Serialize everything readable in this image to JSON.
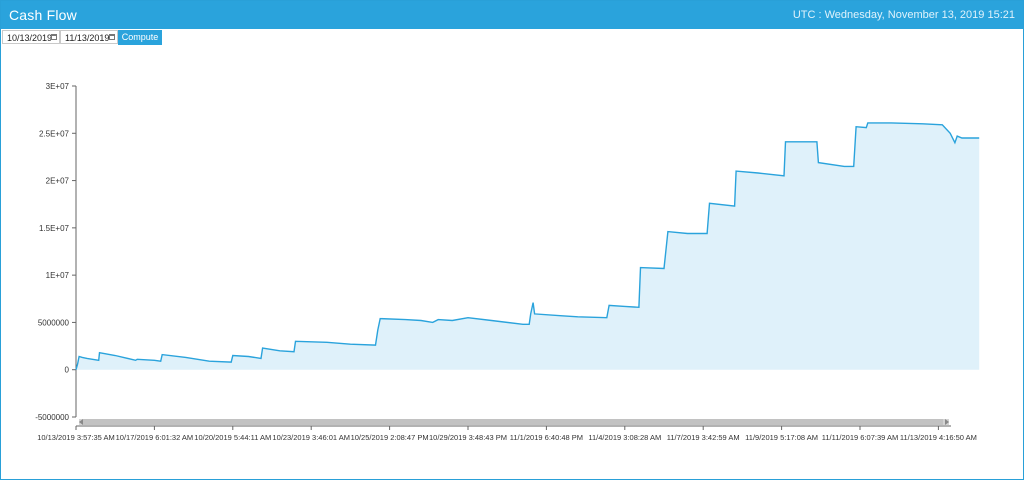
{
  "header": {
    "title": "Cash Flow",
    "clock": "UTC : Wednesday, November 13, 2019 15:21"
  },
  "toolbar": {
    "start_date": "10/13/2019",
    "end_date": "11/13/2019",
    "compute_label": "Compute"
  },
  "colors": {
    "accent": "#2aa3dc",
    "line": "#2aa3dc",
    "area": "#dff1fa"
  },
  "chart_data": {
    "type": "area",
    "title": "",
    "xlabel": "",
    "ylabel": "",
    "ylim": [
      -5000000,
      30000000
    ],
    "yticks": [
      {
        "v": 30000000,
        "label": "3E+07"
      },
      {
        "v": 25000000,
        "label": "2.5E+07"
      },
      {
        "v": 20000000,
        "label": "2E+07"
      },
      {
        "v": 15000000,
        "label": "1.5E+07"
      },
      {
        "v": 10000000,
        "label": "1E+07"
      },
      {
        "v": 5000000,
        "label": "5000000"
      },
      {
        "v": 0,
        "label": "0"
      },
      {
        "v": -5000000,
        "label": "-5000000"
      }
    ],
    "xticks": [
      {
        "t": 0,
        "label": "10/13/2019 3:57:35 AM"
      },
      {
        "t": 1,
        "label": "10/17/2019 6:01:32 AM"
      },
      {
        "t": 2,
        "label": "10/20/2019 5:44:11 AM"
      },
      {
        "t": 3,
        "label": "10/23/2019 3:46:01 AM"
      },
      {
        "t": 4,
        "label": "10/25/2019 2:08:47 PM"
      },
      {
        "t": 5,
        "label": "10/29/2019 3:48:43 PM"
      },
      {
        "t": 6,
        "label": "11/1/2019 6:40:48 PM"
      },
      {
        "t": 7,
        "label": "11/4/2019 3:08:28 AM"
      },
      {
        "t": 8,
        "label": "11/7/2019 3:42:59 AM"
      },
      {
        "t": 9,
        "label": "11/9/2019 5:17:08 AM"
      },
      {
        "t": 10,
        "label": "11/11/2019 6:07:39 AM"
      },
      {
        "t": 11,
        "label": "11/13/2019 4:16:50 AM"
      }
    ],
    "grid": false,
    "legend": "none",
    "series": [
      {
        "points": [
          [
            0.0,
            0
          ],
          [
            0.02,
            600000
          ],
          [
            0.04,
            1400000
          ],
          [
            0.08,
            1300000
          ],
          [
            0.14,
            1200000
          ],
          [
            0.29,
            1000000
          ],
          [
            0.3,
            1800000
          ],
          [
            0.5,
            1500000
          ],
          [
            0.76,
            1000000
          ],
          [
            0.78,
            1100000
          ],
          [
            1.0,
            1000000
          ],
          [
            1.08,
            900000
          ],
          [
            1.1,
            1600000
          ],
          [
            1.4,
            1300000
          ],
          [
            1.7,
            900000
          ],
          [
            1.98,
            800000
          ],
          [
            2.0,
            1500000
          ],
          [
            2.2,
            1400000
          ],
          [
            2.36,
            1200000
          ],
          [
            2.38,
            2300000
          ],
          [
            2.6,
            2000000
          ],
          [
            2.78,
            1900000
          ],
          [
            2.8,
            3000000
          ],
          [
            3.2,
            2900000
          ],
          [
            3.5,
            2700000
          ],
          [
            3.82,
            2600000
          ],
          [
            3.85,
            4200000
          ],
          [
            3.88,
            5400000
          ],
          [
            4.2,
            5300000
          ],
          [
            4.4,
            5200000
          ],
          [
            4.55,
            5000000
          ],
          [
            4.62,
            5300000
          ],
          [
            4.8,
            5200000
          ],
          [
            5.0,
            5500000
          ],
          [
            5.3,
            5200000
          ],
          [
            5.7,
            4800000
          ],
          [
            5.78,
            4800000
          ],
          [
            5.8,
            5900000
          ],
          [
            5.83,
            7100000
          ],
          [
            5.85,
            5900000
          ],
          [
            6.2,
            5700000
          ],
          [
            6.4,
            5600000
          ],
          [
            6.77,
            5500000
          ],
          [
            6.8,
            6800000
          ],
          [
            7.0,
            6700000
          ],
          [
            7.18,
            6600000
          ],
          [
            7.2,
            10800000
          ],
          [
            7.5,
            10700000
          ],
          [
            7.55,
            14600000
          ],
          [
            7.8,
            14400000
          ],
          [
            8.05,
            14400000
          ],
          [
            8.08,
            17600000
          ],
          [
            8.4,
            17300000
          ],
          [
            8.42,
            21000000
          ],
          [
            8.7,
            20800000
          ],
          [
            9.03,
            20500000
          ],
          [
            9.05,
            24100000
          ],
          [
            9.45,
            24100000
          ],
          [
            9.47,
            21900000
          ],
          [
            9.8,
            21500000
          ],
          [
            9.92,
            21500000
          ],
          [
            9.95,
            25700000
          ],
          [
            10.08,
            25600000
          ],
          [
            10.1,
            26100000
          ],
          [
            10.4,
            26100000
          ],
          [
            10.8,
            26000000
          ],
          [
            11.05,
            25900000
          ],
          [
            11.15,
            25000000
          ],
          [
            11.21,
            24000000
          ],
          [
            11.24,
            24700000
          ],
          [
            11.3,
            24500000
          ],
          [
            11.52,
            24500000
          ]
        ]
      }
    ]
  }
}
